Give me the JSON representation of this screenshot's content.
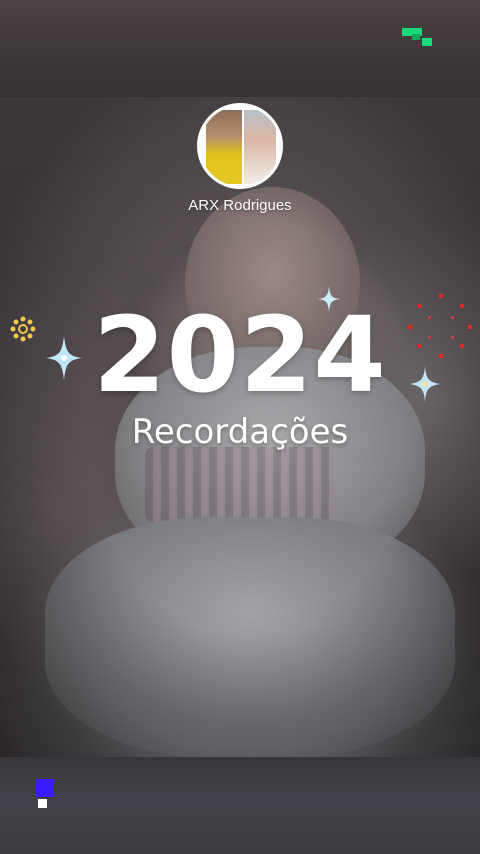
{
  "story": {
    "username": "ARX Rodrigues",
    "year_title": "2024",
    "subtitle": "Recordações"
  },
  "colors": {
    "sparkle_blue": "#9fd8f5",
    "sparkle_gold": "#f3c74a",
    "firework_red": "#e02a2a",
    "brand_green": "#1ad77a",
    "indicator_purple": "#3a1bff"
  },
  "icons": [
    "sparkle-icon",
    "firework-icon",
    "sun-flower-icon",
    "brand-logo-icon",
    "page-indicator-icon"
  ]
}
